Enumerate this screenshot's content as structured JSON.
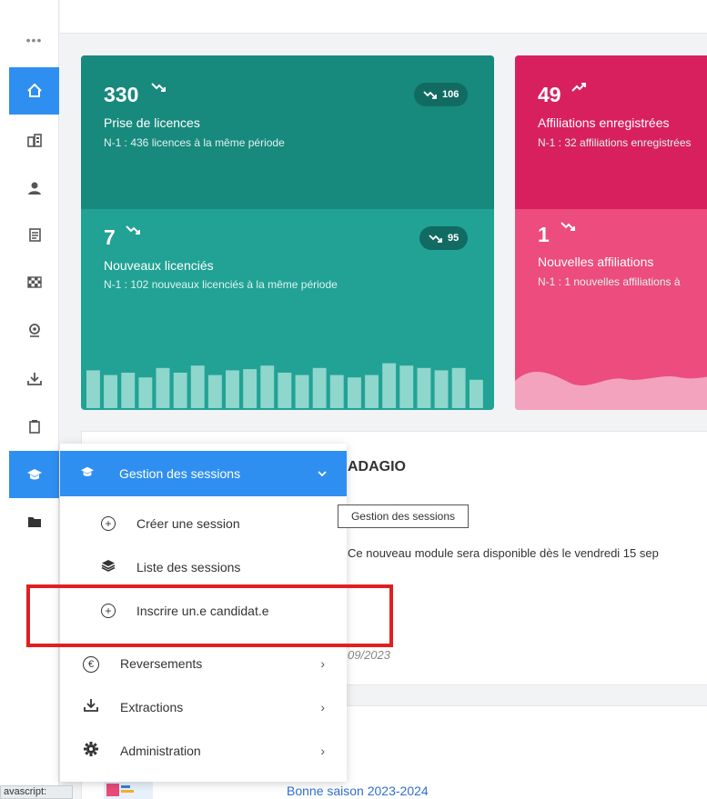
{
  "rail": {
    "dots": "•••",
    "items": [
      {
        "name": "home",
        "glyph": "⌂",
        "active": true
      },
      {
        "name": "buildings",
        "glyph": "▦",
        "active": false
      },
      {
        "name": "user",
        "glyph": "☗",
        "active": false
      },
      {
        "name": "documents",
        "glyph": "▤",
        "active": false
      },
      {
        "name": "flag",
        "glyph": "▩",
        "active": false
      },
      {
        "name": "map-pin",
        "glyph": "◉",
        "active": false
      },
      {
        "name": "download",
        "glyph": "⇩",
        "active": false
      },
      {
        "name": "clipboard",
        "glyph": "▣",
        "active": false
      },
      {
        "name": "graduation-cap",
        "glyph": "▲",
        "active": true
      },
      {
        "name": "folder",
        "glyph": "▬",
        "active": false
      }
    ]
  },
  "stats": {
    "licences": {
      "value": "330",
      "label": "Prise de licences",
      "sub": "N-1 : 436 licences à la même période",
      "delta": "106"
    },
    "new_licensees": {
      "value": "7",
      "label": "Nouveaux licenciés",
      "sub": "N-1 : 102 nouveaux licenciés à la même période",
      "delta": "95"
    },
    "affiliations": {
      "value": "49",
      "label": "Affiliations enregistrées",
      "sub": "N-1 : 32 affiliations enregistrées"
    },
    "new_affiliations": {
      "value": "1",
      "label": "Nouvelles affiliations",
      "sub": "N-1 : 1 nouvelles affiliations à"
    }
  },
  "news": {
    "title": "ADAGIO",
    "text": "Ce nouveau module sera disponible dès le vendredi 15 sep",
    "date": "09/2023"
  },
  "season": {
    "link": "Bonne saison 2023-2024"
  },
  "menu": {
    "header": "Gestion des sessions",
    "sub_items": [
      {
        "label": "Créer une session",
        "icon": "plus-circle-icon"
      },
      {
        "label": "Liste des sessions",
        "icon": "layers-icon"
      },
      {
        "label": "Inscrire un.e candidat.e",
        "icon": "plus-circle-icon"
      }
    ],
    "top_items": [
      {
        "label": "Reversements",
        "icon": "euro-icon"
      },
      {
        "label": "Extractions",
        "icon": "download-icon"
      },
      {
        "label": "Administration",
        "icon": "gear-icon"
      }
    ]
  },
  "tooltip": "Gestion des sessions",
  "status_bar": "avascript:",
  "chart_data": {
    "type": "bar",
    "values": [
      32,
      28,
      30,
      26,
      34,
      30,
      36,
      28,
      32,
      33,
      36,
      30,
      28,
      34,
      28,
      26,
      28,
      38,
      36,
      34,
      32,
      34,
      24
    ]
  },
  "colors": {
    "accent": "#2f8ff0",
    "green_dark": "#18897d",
    "green": "#21a295",
    "pink_dark": "#d9205e",
    "pink": "#ec4c7e",
    "highlight": "#e02020"
  }
}
